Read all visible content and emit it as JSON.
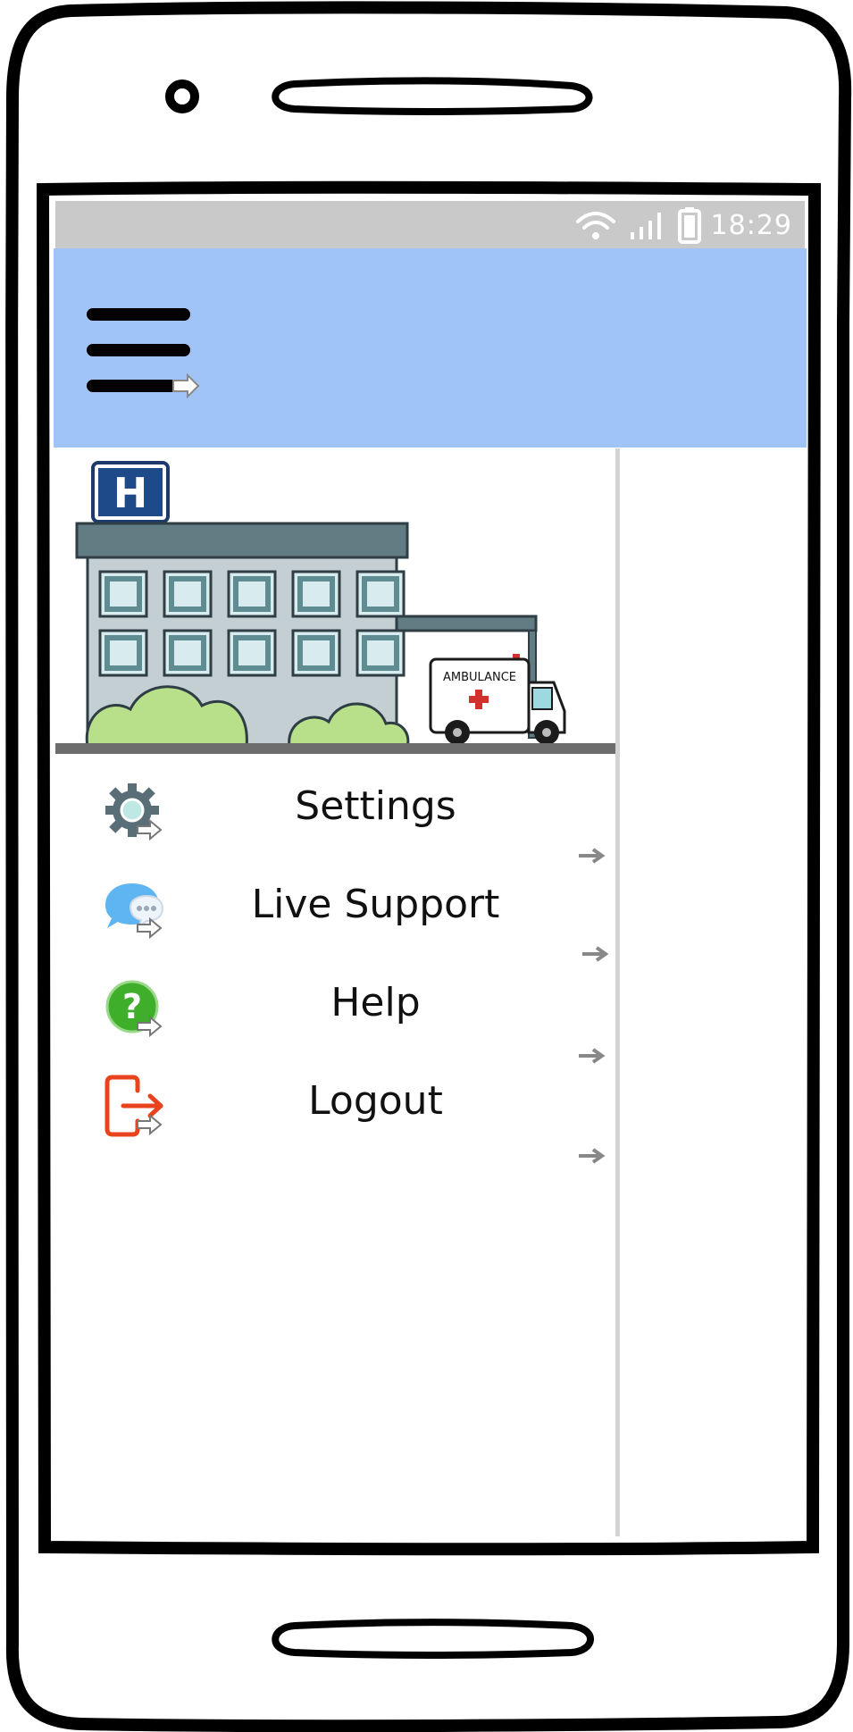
{
  "status_bar": {
    "time": "18:29",
    "icons": [
      "wifi-icon",
      "signal-icon",
      "battery-icon"
    ]
  },
  "app_bar": {
    "menu_icon": "hamburger-menu-icon",
    "background": "#a0c4f6"
  },
  "drawer": {
    "header_image": {
      "sign_letter": "H",
      "vehicle_text": "AMBULANCE"
    },
    "items": [
      {
        "label": "Settings",
        "icon": "gear-icon",
        "color": "#5a6e78"
      },
      {
        "label": "Live Support",
        "icon": "chat-bubble-icon",
        "color": "#4aa3f0"
      },
      {
        "label": "Help",
        "icon": "help-icon",
        "color": "#3fae2a"
      },
      {
        "label": "Logout",
        "icon": "logout-icon",
        "color": "#e8431c"
      }
    ]
  },
  "colors": {
    "status_bar": "#c9c9c9",
    "drawer_edge": "#d4d4d4"
  }
}
